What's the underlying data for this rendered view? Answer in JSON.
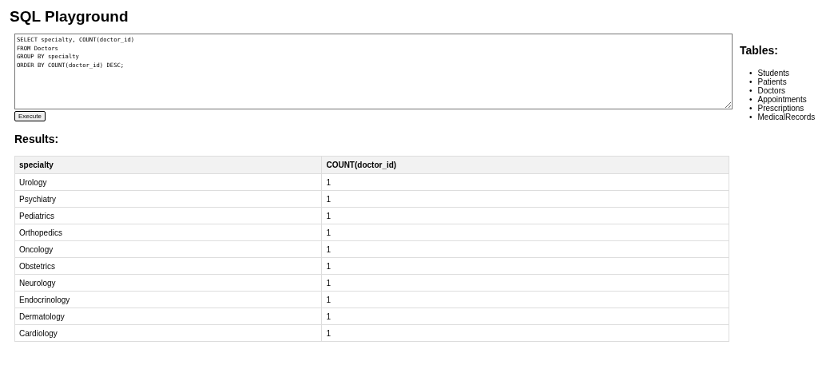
{
  "title": "SQL Playground",
  "query": {
    "value": "SELECT specialty, COUNT(doctor_id)\nFROM Doctors\nGROUP BY specialty\nORDER BY COUNT(doctor_id) DESC;"
  },
  "execute_button": "Execute",
  "results": {
    "heading": "Results:",
    "columns": [
      "specialty",
      "COUNT(doctor_id)"
    ],
    "rows": [
      [
        "Urology",
        "1"
      ],
      [
        "Psychiatry",
        "1"
      ],
      [
        "Pediatrics",
        "1"
      ],
      [
        "Orthopedics",
        "1"
      ],
      [
        "Oncology",
        "1"
      ],
      [
        "Obstetrics",
        "1"
      ],
      [
        "Neurology",
        "1"
      ],
      [
        "Endocrinology",
        "1"
      ],
      [
        "Dermatology",
        "1"
      ],
      [
        "Cardiology",
        "1"
      ]
    ]
  },
  "sidebar": {
    "heading": "Tables:",
    "items": [
      {
        "marker": "•",
        "label": "Students"
      },
      {
        "marker": "•",
        "label": "Patients"
      },
      {
        "marker": "•",
        "label": "Doctors"
      },
      {
        "marker": "•",
        "label": "Appointments"
      },
      {
        "marker": "•",
        "label": "Prescriptions"
      },
      {
        "marker": "•",
        "label": "MedicalRecords"
      }
    ]
  }
}
